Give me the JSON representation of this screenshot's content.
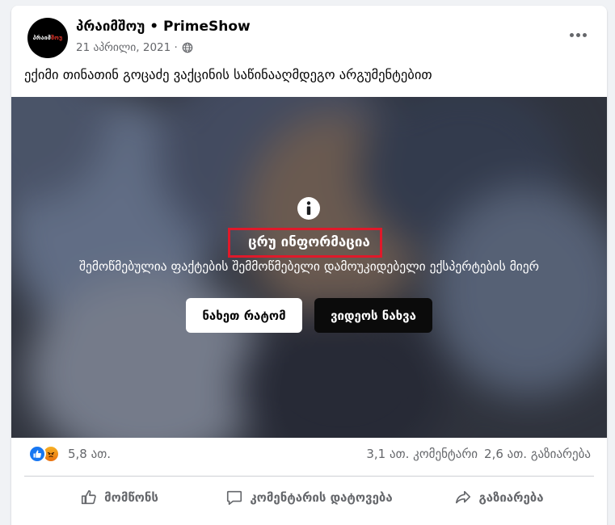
{
  "post": {
    "page_name": "პრაიმშოუ • PrimeShow",
    "avatar_text_white": "პრაიმ",
    "avatar_text_red": "შოუ",
    "date": "21 აპრილი, 2021 ·",
    "privacy_icon": "globe-icon",
    "more_icon": "more-horizontal-icon",
    "text": "ექიმი თინათინ გოცაძე ვაქცინის საწინააღმდეგო არგუმენტებით"
  },
  "media": {
    "info_icon": "info-icon",
    "warning_label": "ცრუ ინფორმაცია",
    "checked_by": "შემოწმებულია ფაქტების შემმოწმებელი დამოუკიდებელი ექსპერტების მიერ",
    "see_why_label": "ნახეთ რატომ",
    "watch_video_label": "ვიდეოს ნახვა",
    "highlight_color": "#e0192a"
  },
  "engagement": {
    "reaction_icons": [
      "like-reaction-icon",
      "angry-reaction-icon"
    ],
    "reaction_count": "5,8 ათ.",
    "comments": "3,1 ათ. კომენტარი",
    "shares": "2,6 ათ. გაზიარება"
  },
  "actions": {
    "like": "მომწონს",
    "comment": "კომენტარის დატოვება",
    "share": "გაზიარება"
  },
  "colors": {
    "brand_blue": "#1877f2",
    "secondary_text": "#65676b"
  }
}
